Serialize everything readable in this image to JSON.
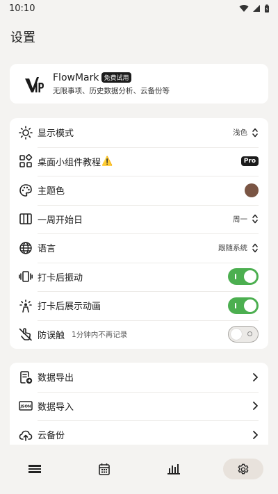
{
  "status_bar": {
    "time": "10:10"
  },
  "page": {
    "title": "设置"
  },
  "vip": {
    "title": "FlowMark",
    "badge": "免费试用",
    "subtitle": "无限事项、历史数据分析、云备份等"
  },
  "settings": {
    "display_mode": {
      "label": "显示模式",
      "value": "浅色"
    },
    "widget_tutorial": {
      "label": "桌面小组件教程",
      "warning": "⚠️",
      "badge": "Pro"
    },
    "theme_color": {
      "label": "主题色",
      "color": "#7a5544"
    },
    "week_start": {
      "label": "一周开始日",
      "value": "周一"
    },
    "language": {
      "label": "语言",
      "value": "跟随系统"
    },
    "vibrate_after_checkin": {
      "label": "打卡后振动",
      "enabled": true
    },
    "animation_after_checkin": {
      "label": "打卡后展示动画",
      "enabled": true
    },
    "anti_mistouch": {
      "label": "防误触",
      "subtitle": "1分钟内不再记录",
      "enabled": false
    }
  },
  "data_section": {
    "export": {
      "label": "数据导出"
    },
    "import": {
      "label": "数据导入"
    },
    "cloud_backup": {
      "label": "云备份"
    }
  },
  "bottom_nav": {
    "items": [
      {
        "icon": "list-icon"
      },
      {
        "icon": "calendar-icon"
      },
      {
        "icon": "bar-chart-icon"
      },
      {
        "icon": "gear-icon",
        "active": true
      }
    ]
  },
  "colors": {
    "accent_green": "#4caf50",
    "background": "#f4f3f1"
  }
}
